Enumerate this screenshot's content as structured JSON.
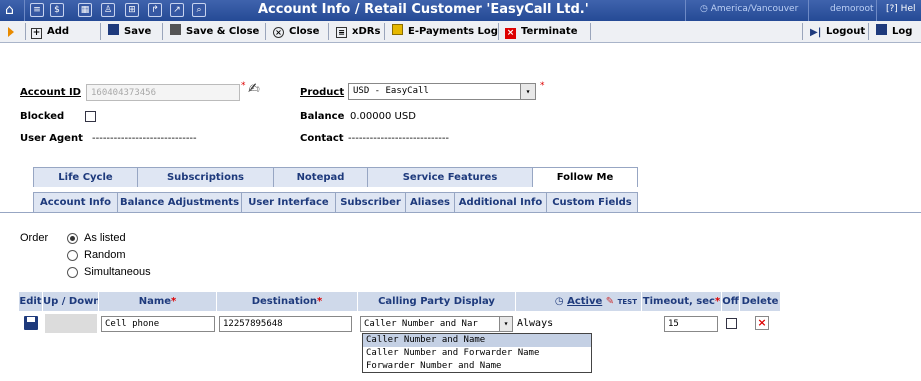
{
  "titlebar": {
    "title": "Account Info / Retail Customer 'EasyCall Ltd.'",
    "timezone": "America/Vancouver",
    "user": "demoroot",
    "help": "Hel"
  },
  "toolbar": {
    "add": "Add",
    "save": "Save",
    "save_close": "Save & Close",
    "close": "Close",
    "xdrs": "xDRs",
    "epayments": "E-Payments Log",
    "terminate": "Terminate",
    "logout": "Logout",
    "log": "Log"
  },
  "account": {
    "id_label": "Account ID",
    "id_value": "160404373456",
    "product_label": "Product",
    "product_value": "USD - EasyCall",
    "blocked_label": "Blocked",
    "balance_label": "Balance",
    "balance_value": "0.00000 USD",
    "user_agent_label": "User Agent",
    "user_agent_value": "-----------------------------",
    "contact_label": "Contact",
    "contact_value": "----------------------------"
  },
  "tabs": {
    "row1": [
      "Life Cycle",
      "Subscriptions",
      "Notepad",
      "Service Features",
      "Follow Me"
    ],
    "row2": [
      "Account Info",
      "Balance Adjustments",
      "User Interface",
      "Subscriber",
      "Aliases",
      "Additional Info",
      "Custom Fields"
    ]
  },
  "followme": {
    "order_label": "Order",
    "options": [
      "As listed",
      "Random",
      "Simultaneous"
    ],
    "selected_option": "As listed",
    "columns": {
      "edit": "Edit",
      "updown": "Up / Down",
      "name": "Name",
      "destination": "Destination",
      "cpd": "Calling Party Display",
      "active": "Active",
      "timeout": "Timeout, sec",
      "off": "Off",
      "delete": "Delete"
    },
    "row": {
      "name": "Cell phone",
      "destination": "12257895648",
      "cpd": "Caller Number and Nar",
      "active": "Always",
      "timeout": "15"
    },
    "cpd_options": [
      "Caller Number and Name",
      "Caller Number and Forwarder Name",
      "Forwarder Number and Name"
    ],
    "cpd_highlighted": "Caller Number and Name"
  }
}
